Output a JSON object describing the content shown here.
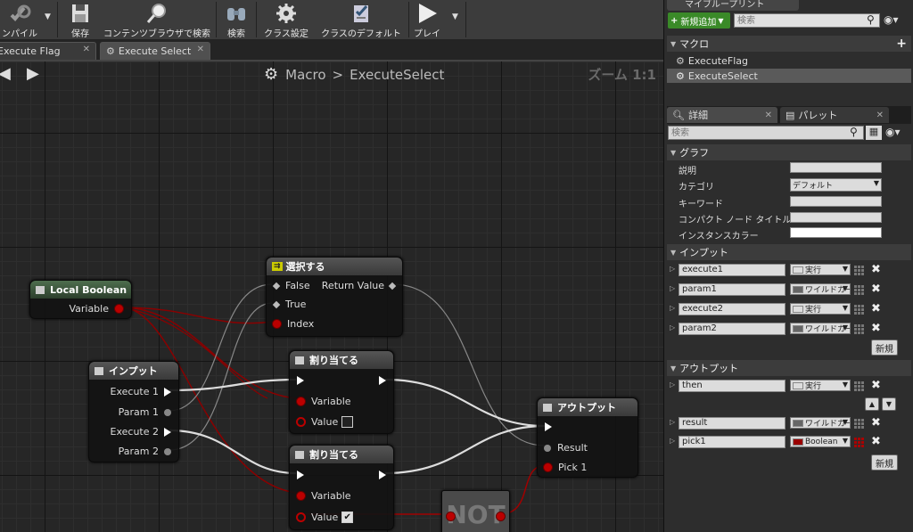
{
  "toolbar": {
    "compile": "ンパイル",
    "save": "保存",
    "browse": "コンテンツブラウザで検索",
    "search": "検索",
    "class_settings": "クラス設定",
    "class_defaults": "クラスのデフォルト",
    "play": "プレイ"
  },
  "tabs": [
    {
      "label": "Execute Flag"
    },
    {
      "label": "Execute Select"
    }
  ],
  "graph": {
    "breadcrumb_macro": "Macro",
    "breadcrumb_sep": ">",
    "breadcrumb_name": "ExecuteSelect",
    "zoom": "ズーム 1:1",
    "local_boolean": {
      "title": "Local Boolean",
      "variable": "Variable"
    },
    "select": {
      "title": "選択する",
      "false": "False",
      "true": "True",
      "index": "Index",
      "return_value": "Return Value"
    },
    "input": {
      "title": "インプット",
      "execute1": "Execute 1",
      "param1": "Param 1",
      "execute2": "Execute 2",
      "param2": "Param 2"
    },
    "assign1": {
      "title": "割り当てる",
      "variable": "Variable",
      "value": "Value",
      "checked": false
    },
    "assign2": {
      "title": "割り当てる",
      "variable": "Variable",
      "value": "Value",
      "checked": true
    },
    "output": {
      "title": "アウトプット",
      "result": "Result",
      "pick1": "Pick 1"
    },
    "not_label": "NOT"
  },
  "panel": {
    "top_tab": "マイブループリント",
    "add_new": "新規追加",
    "search_placeholder": "検索",
    "macros_header": "マクロ",
    "macros": [
      {
        "label": "ExecuteFlag"
      },
      {
        "label": "ExecuteSelect"
      }
    ],
    "details_tab": "詳細",
    "palette_tab": "パレット",
    "details_search": "検索",
    "graph_section": "グラフ",
    "desc_label": "説明",
    "category_label": "カテゴリ",
    "category_value": "デフォルト",
    "keyword_label": "キーワード",
    "compact_label": "コンパクト ノード タイトル",
    "instance_color_label": "インスタンスカラー",
    "inputs_section": "インプット",
    "inputs": [
      {
        "name": "execute1",
        "type": "実行"
      },
      {
        "name": "param1",
        "type": "ワイルドカード"
      },
      {
        "name": "execute2",
        "type": "実行"
      },
      {
        "name": "param2",
        "type": "ワイルドカード"
      }
    ],
    "new_button": "新規",
    "outputs_section": "アウトプット",
    "outputs": [
      {
        "name": "then",
        "type": "実行"
      },
      {
        "name": "result",
        "type": "ワイルドカード"
      },
      {
        "name": "pick1",
        "type": "Boolean"
      }
    ],
    "new_button2": "新規"
  }
}
